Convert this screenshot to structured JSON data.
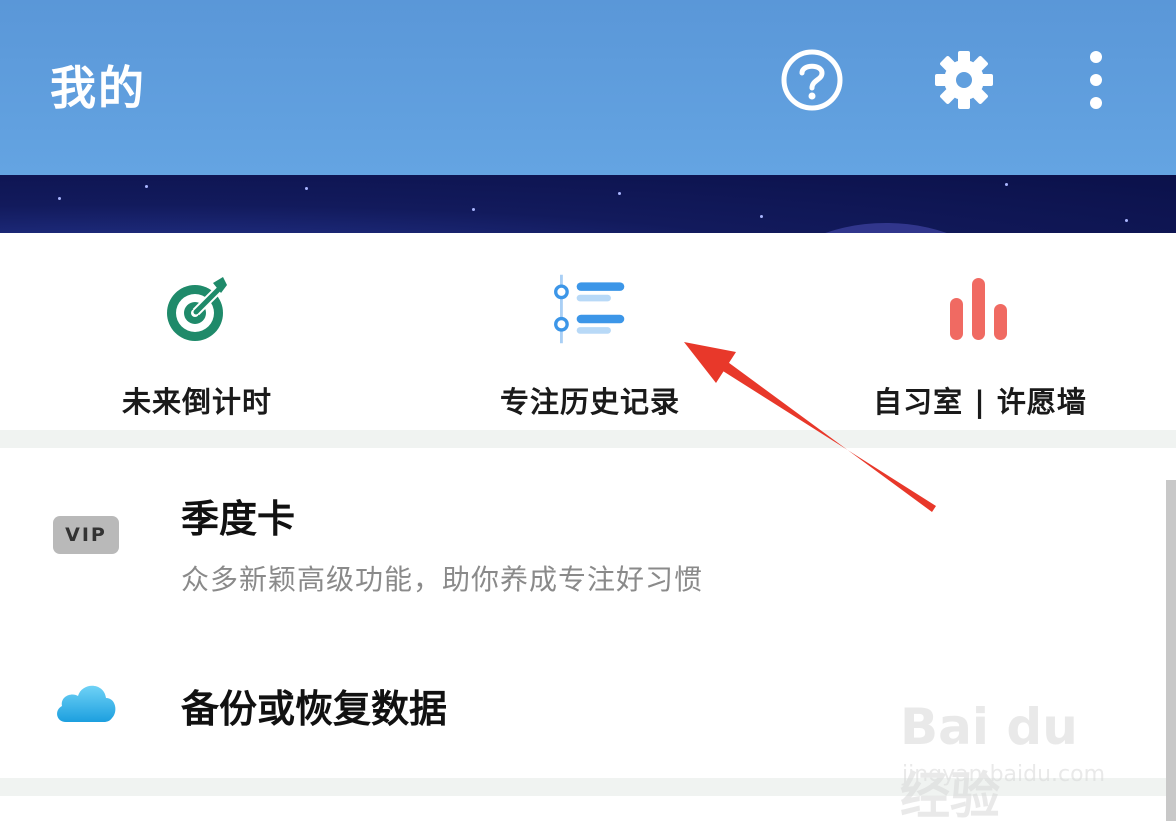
{
  "header": {
    "title": "我的",
    "icons": [
      "help-icon",
      "settings-icon",
      "more-vertical-icon"
    ],
    "color": "#5e9ddd"
  },
  "quick_actions": [
    {
      "label": "未来倒计时",
      "icon": "target-icon",
      "color": "#1f8a6a"
    },
    {
      "label": "专注历史记录",
      "icon": "timeline-list-icon",
      "color": "#3c96e8"
    },
    {
      "label": "自习室 | 许愿墙",
      "icon": "bar-chart-icon",
      "color": "#f06a62"
    }
  ],
  "list": {
    "vip": {
      "badge": "VIP",
      "title": "季度卡",
      "subtitle": "众多新颖高级功能，助你养成专注好习惯"
    },
    "backup": {
      "title": "备份或恢复数据",
      "icon": "cloud-icon"
    }
  },
  "watermark": {
    "logo": "Bai du 经验",
    "url": "jingyan.baidu.com"
  },
  "annotation": {
    "color": "#e8382a"
  }
}
